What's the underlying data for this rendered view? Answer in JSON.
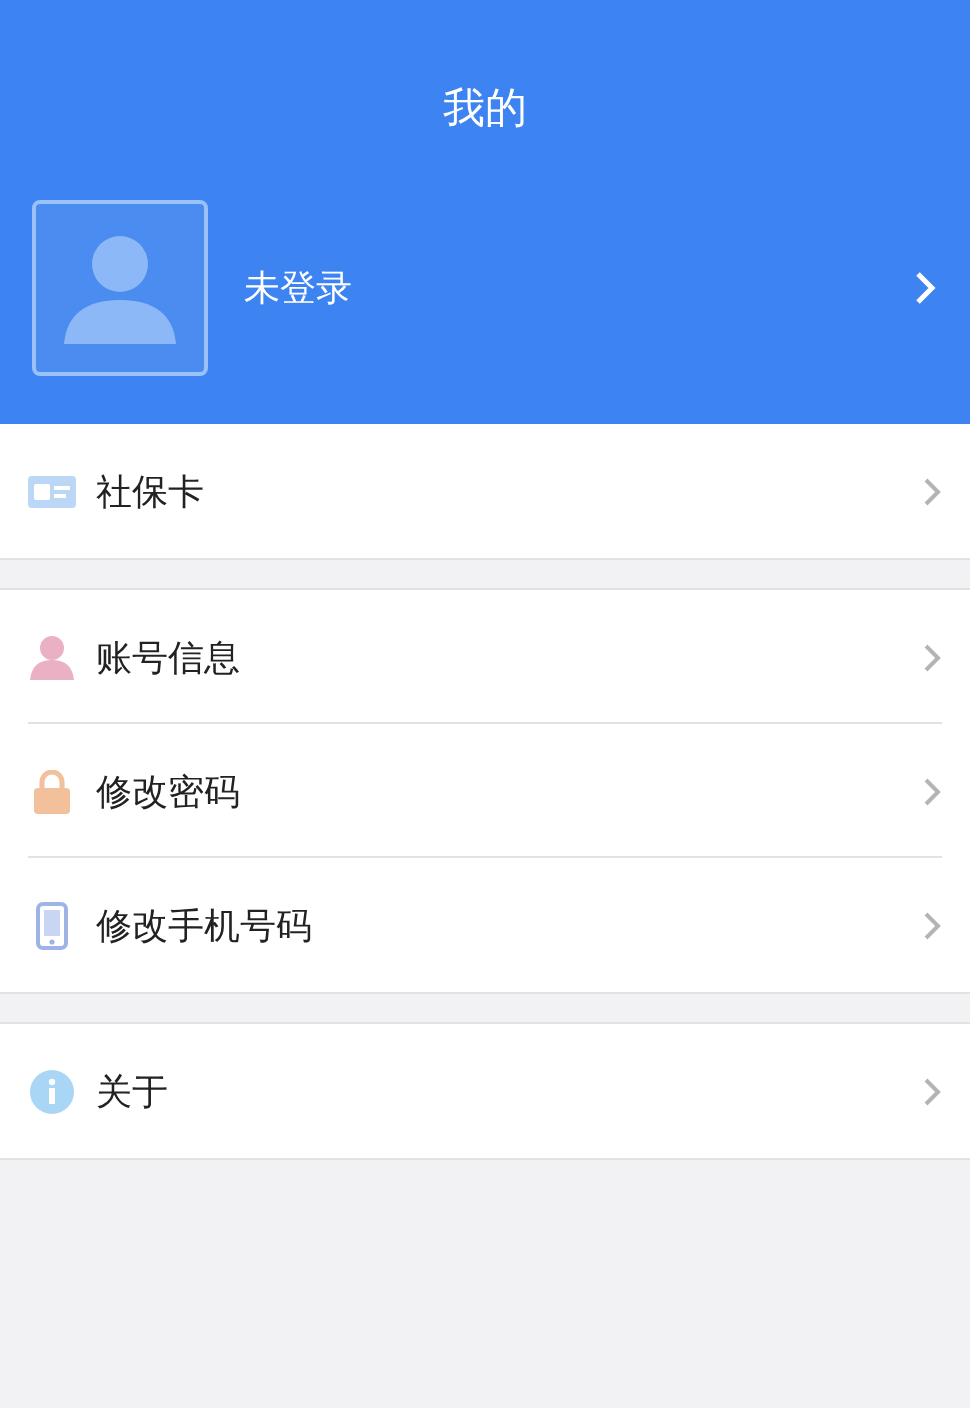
{
  "header": {
    "title": "我的"
  },
  "profile": {
    "name": "未登录"
  },
  "sections": [
    {
      "items": [
        {
          "label": "社保卡",
          "kind": "card"
        }
      ]
    },
    {
      "items": [
        {
          "label": "账号信息",
          "kind": "person"
        },
        {
          "label": "修改密码",
          "kind": "lock"
        },
        {
          "label": "修改手机号码",
          "kind": "phone"
        }
      ]
    },
    {
      "items": [
        {
          "label": "关于",
          "kind": "info"
        }
      ]
    }
  ]
}
